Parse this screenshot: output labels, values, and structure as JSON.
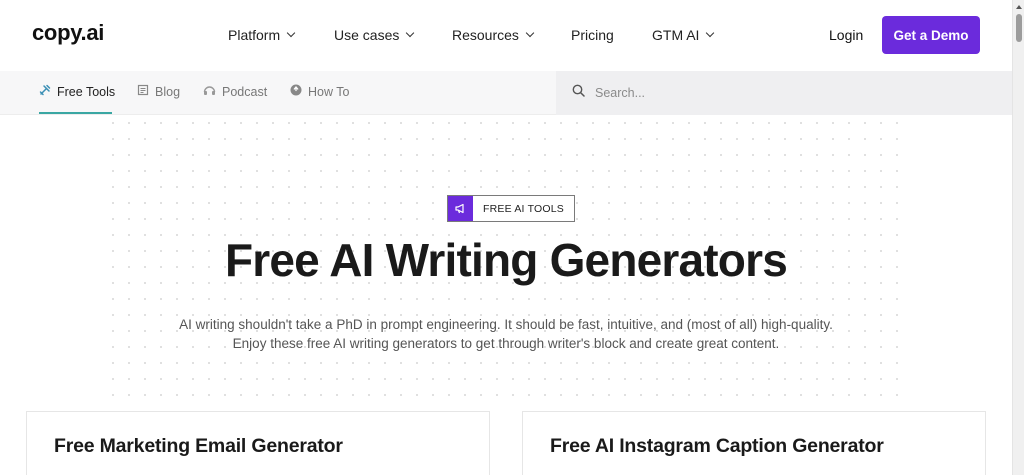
{
  "header": {
    "logo": "copy.ai",
    "nav": [
      {
        "label": "Platform",
        "has_dropdown": true
      },
      {
        "label": "Use cases",
        "has_dropdown": true
      },
      {
        "label": "Resources",
        "has_dropdown": true
      },
      {
        "label": "Pricing",
        "has_dropdown": false
      },
      {
        "label": "GTM AI",
        "has_dropdown": true
      }
    ],
    "login_label": "Login",
    "demo_label": "Get a Demo",
    "demo_color": "#6b2bdc"
  },
  "subnav": {
    "items": [
      {
        "label": "Free Tools",
        "icon": "tools-icon",
        "active": true
      },
      {
        "label": "Blog",
        "icon": "blog-icon",
        "active": false
      },
      {
        "label": "Podcast",
        "icon": "podcast-icon",
        "active": false
      },
      {
        "label": "How To",
        "icon": "how-to-icon",
        "active": false
      }
    ],
    "search_placeholder": "Search...",
    "active_underline_color": "#3aa7a3"
  },
  "hero": {
    "badge_label": "FREE AI TOOLS",
    "badge_icon": "megaphone-icon",
    "title": "Free AI Writing Generators",
    "subtitle_line1": "AI writing shouldn't take a PhD in prompt engineering. It should be fast, intuitive, and (most of all) high-quality.",
    "subtitle_line2": "Enjoy these free AI writing generators to get through writer's block and create great content."
  },
  "cards": [
    {
      "title": "Free Marketing Email Generator"
    },
    {
      "title": "Free AI Instagram Caption Generator"
    }
  ]
}
